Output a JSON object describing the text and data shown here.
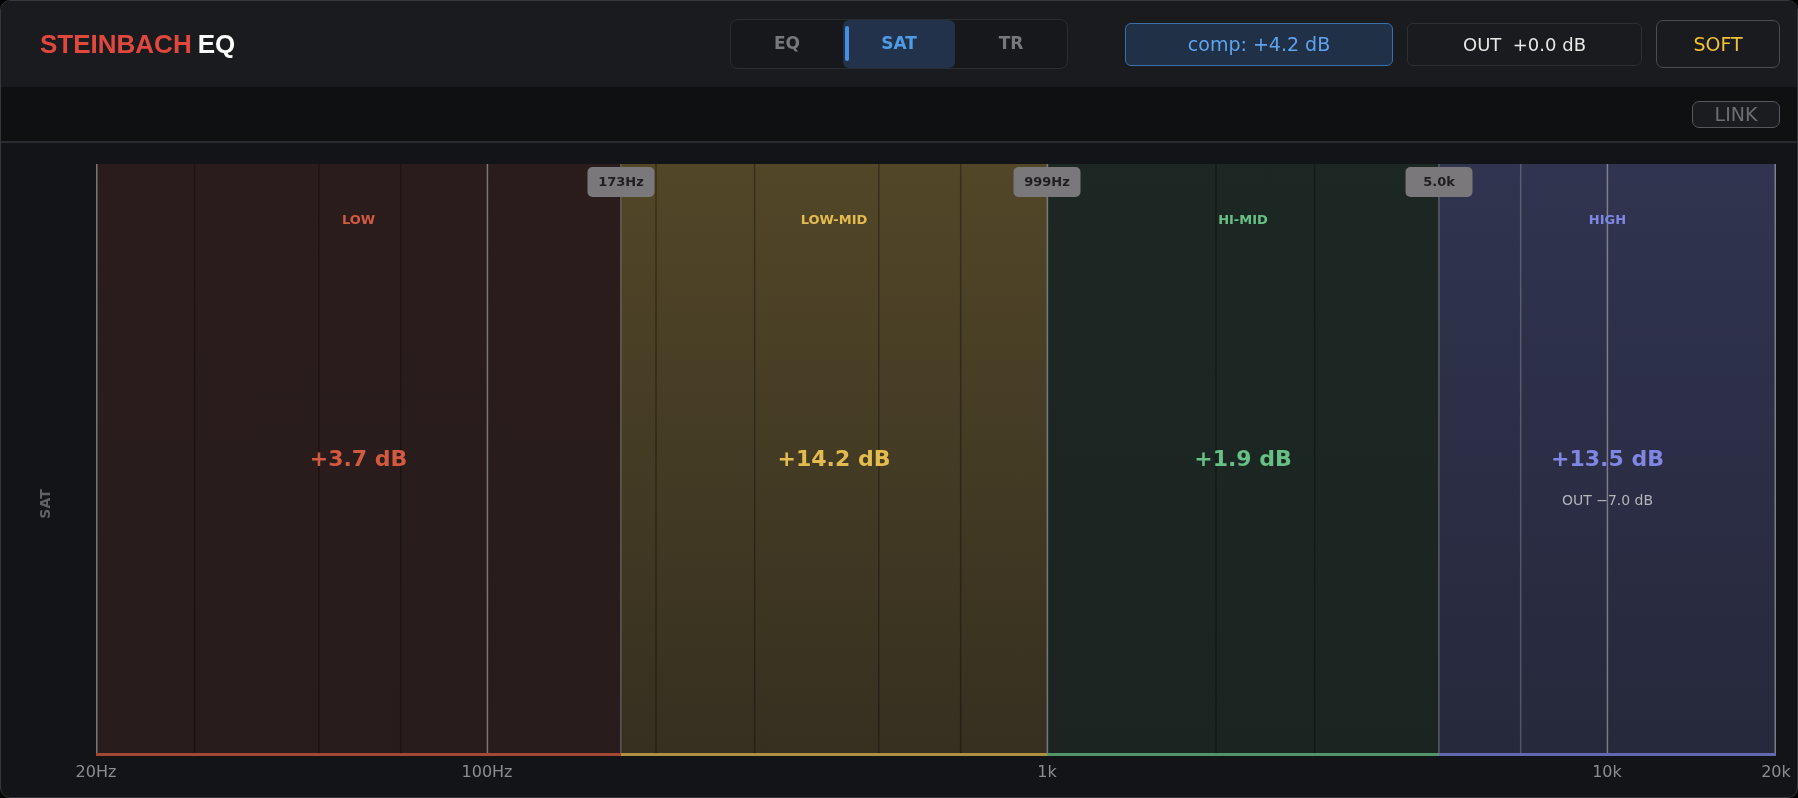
{
  "header": {
    "logo": {
      "brand": "STEINBACH",
      "product": "EQ"
    },
    "modes": [
      {
        "label": "EQ",
        "selected": false
      },
      {
        "label": "SAT",
        "selected": true
      },
      {
        "label": "TR",
        "selected": false
      }
    ],
    "compensation": {
      "label": "comp: +4.2 dB",
      "active": true
    },
    "output_gain": "OUT  +0.0 dB",
    "saturation_mode": "SOFT"
  },
  "toolbar": {
    "link": {
      "label": "LINK",
      "on": false
    }
  },
  "display": {
    "axis_title": "SAT",
    "bands": [
      {
        "name": "LOW",
        "gain": "+3.7 dB",
        "color": "#d35a40"
      },
      {
        "name": "LOW-MID",
        "gain": "+14.2 dB",
        "color": "#e4bb4e"
      },
      {
        "name": "HI-MID",
        "gain": "+1.9 dB",
        "color": "#67c084"
      },
      {
        "name": "HIGH",
        "gain": "+13.5 dB",
        "output": "OUT −7.0 dB",
        "color": "#7f86e4"
      }
    ],
    "crossovers": [
      "173Hz",
      "999Hz",
      "5.0k"
    ],
    "frequency_labels": [
      "20Hz",
      "100Hz",
      "1k",
      "10k",
      "20k"
    ]
  }
}
